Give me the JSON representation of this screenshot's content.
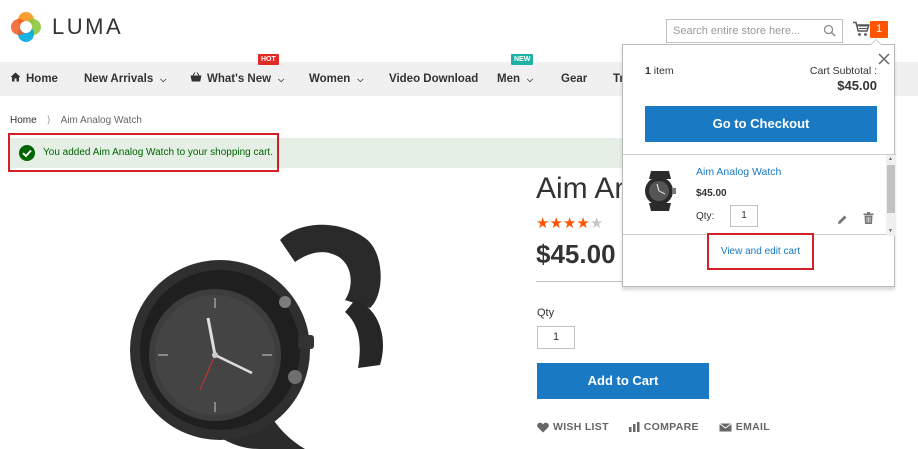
{
  "header": {
    "logo_text": "LUMA",
    "search_placeholder": "Search entire store here...",
    "cart_count": "1"
  },
  "nav": {
    "items": [
      {
        "label": "Home"
      },
      {
        "label": "New Arrivals"
      },
      {
        "label": "What's New",
        "badge": "HOT"
      },
      {
        "label": "Women"
      },
      {
        "label": "Video Download"
      },
      {
        "label": "Men",
        "badge": "NEW"
      },
      {
        "label": "Gear"
      },
      {
        "label": "Tr"
      }
    ]
  },
  "breadcrumb": {
    "home": "Home",
    "current": "Aim Analog Watch"
  },
  "message": {
    "text": "You added Aim Analog Watch to your shopping cart."
  },
  "product": {
    "title": "Aim An",
    "rating_stars": 4,
    "rating_max": 5,
    "price": "$45.00",
    "qty_label": "Qty",
    "qty_value": "1",
    "add_to_cart": "Add to Cart",
    "actions": {
      "wishlist": "WISH LIST",
      "compare": "COMPARE",
      "email": "EMAIL"
    }
  },
  "minicart": {
    "count_number": "1",
    "count_label": "item",
    "subtotal_label": "Cart Subtotal :",
    "subtotal": "$45.00",
    "checkout": "Go to Checkout",
    "item": {
      "name": "Aim Analog Watch",
      "price": "$45.00",
      "qty_label": "Qty:",
      "qty_value": "1"
    },
    "view_edit": "View and edit cart"
  },
  "colors": {
    "accent_blue": "#1979c3",
    "badge_orange": "#ff5501",
    "success_green": "#006400",
    "success_bg": "#e5efe5",
    "highlight_red": "#d32027"
  },
  "icons": [
    "luma-logo-icon",
    "search-icon",
    "cart-icon",
    "home-icon",
    "basket-icon",
    "chevron-down-icon",
    "breadcrumb-separator-icon",
    "check-icon",
    "star-icon",
    "heart-icon",
    "compare-icon",
    "email-icon",
    "close-icon",
    "edit-icon",
    "trash-icon"
  ]
}
